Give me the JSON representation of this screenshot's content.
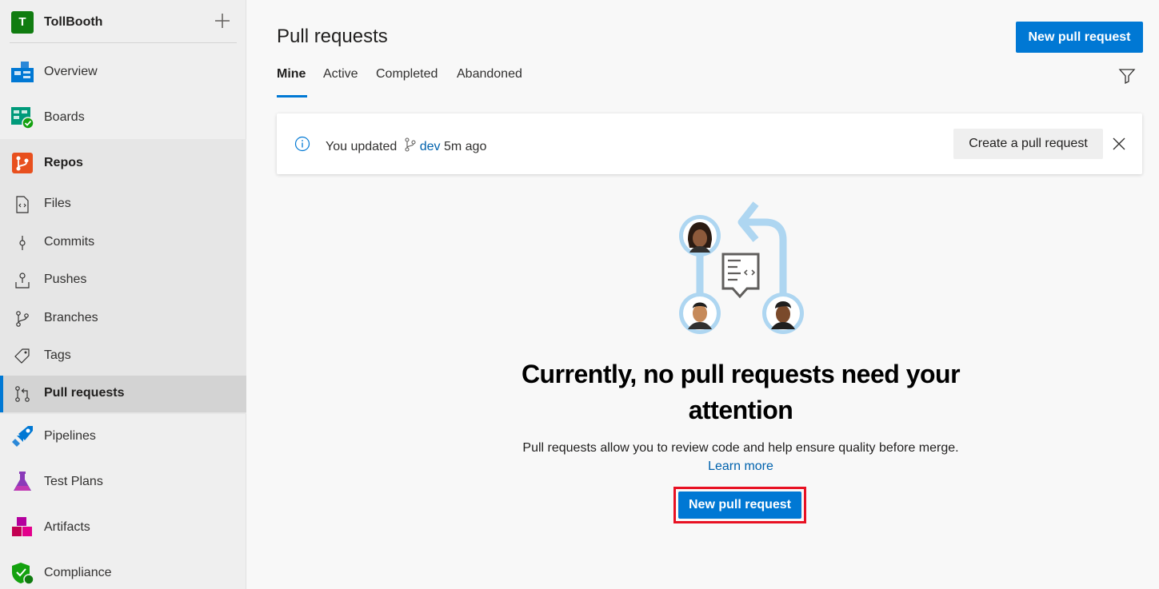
{
  "project": {
    "avatar_letter": "T",
    "name": "TollBooth",
    "avatar_color": "#107c10"
  },
  "nav": {
    "overview": "Overview",
    "boards": "Boards",
    "repos": "Repos",
    "repos_sub": {
      "files": "Files",
      "commits": "Commits",
      "pushes": "Pushes",
      "branches": "Branches",
      "tags": "Tags",
      "pull_requests": "Pull requests"
    },
    "pipelines": "Pipelines",
    "test_plans": "Test Plans",
    "artifacts": "Artifacts",
    "compliance": "Compliance"
  },
  "page": {
    "title": "Pull requests",
    "new_pr_button": "New pull request",
    "tabs": [
      "Mine",
      "Active",
      "Completed",
      "Abandoned"
    ],
    "active_tab": "Mine"
  },
  "banner": {
    "prefix": "You updated",
    "branch": "dev",
    "suffix": "5m ago",
    "action": "Create a pull request"
  },
  "empty_state": {
    "title_line1": "Currently, no pull requests need your",
    "title_line2": "attention",
    "description": "Pull requests allow you to review code and help ensure quality before merge.",
    "learn_more": "Learn more",
    "button": "New pull request"
  },
  "colors": {
    "accent": "#0078d4",
    "highlight_border": "#e81123"
  }
}
